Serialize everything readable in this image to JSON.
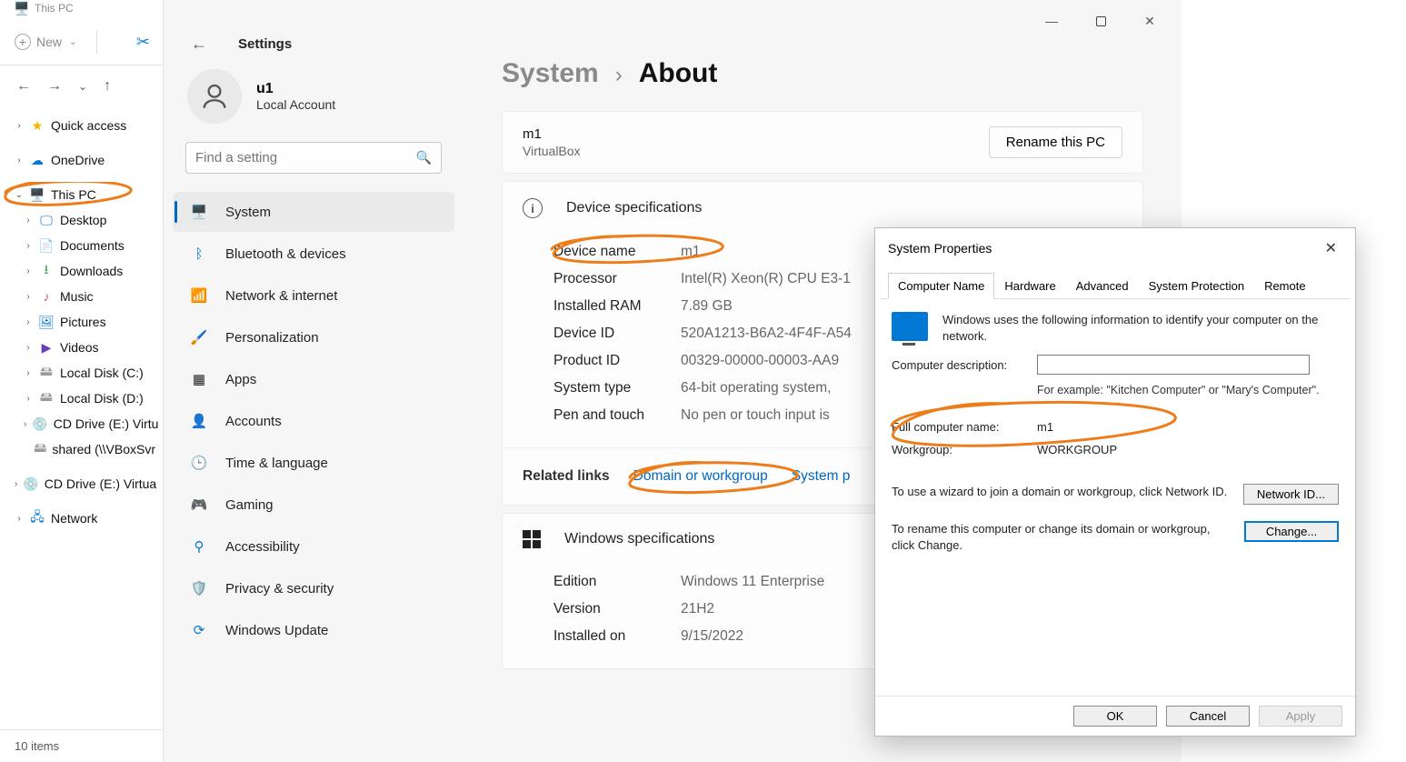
{
  "explorer": {
    "title": "This PC",
    "new_btn": "New",
    "status": "10 items",
    "tree": {
      "quick_access": "Quick access",
      "onedrive": "OneDrive",
      "this_pc": "This PC",
      "desktop": "Desktop",
      "documents": "Documents",
      "downloads": "Downloads",
      "music": "Music",
      "pictures": "Pictures",
      "videos": "Videos",
      "local_c": "Local Disk (C:)",
      "local_d": "Local Disk (D:)",
      "cd_e1": "CD Drive (E:) Virtu",
      "shared": "shared (\\\\VBoxSvr",
      "cd_e2": "CD Drive (E:) Virtua",
      "network": "Network"
    }
  },
  "settings": {
    "window_title": "Settings",
    "user": {
      "name": "u1",
      "sub": "Local Account"
    },
    "search_placeholder": "Find a setting",
    "nav": {
      "system": "System",
      "bluetooth": "Bluetooth & devices",
      "network": "Network & internet",
      "personalization": "Personalization",
      "apps": "Apps",
      "accounts": "Accounts",
      "time": "Time & language",
      "gaming": "Gaming",
      "accessibility": "Accessibility",
      "privacy": "Privacy & security",
      "update": "Windows Update"
    },
    "breadcrumb": {
      "root": "System",
      "page": "About"
    },
    "pc": {
      "name": "m1",
      "model": "VirtualBox",
      "rename": "Rename this PC"
    },
    "device_spec_title": "Device specifications",
    "specs": {
      "device_name_l": "Device name",
      "device_name_v": "m1",
      "processor_l": "Processor",
      "processor_v": "Intel(R) Xeon(R) CPU E3-1",
      "ram_l": "Installed RAM",
      "ram_v": "7.89 GB",
      "deviceid_l": "Device ID",
      "deviceid_v": "520A1213-B6A2-4F4F-A54",
      "productid_l": "Product ID",
      "productid_v": "00329-00000-00003-AA9",
      "systype_l": "System type",
      "systype_v": "64-bit operating system,",
      "pen_l": "Pen and touch",
      "pen_v": "No pen or touch input is"
    },
    "related": {
      "label": "Related links",
      "domain": "Domain or workgroup",
      "sysprot": "System p"
    },
    "winspec_title": "Windows specifications",
    "winspecs": {
      "edition_l": "Edition",
      "edition_v": "Windows 11 Enterprise",
      "version_l": "Version",
      "version_v": "21H2",
      "installed_l": "Installed on",
      "installed_v": "9/15/2022"
    }
  },
  "sysprops": {
    "title": "System Properties",
    "tabs": {
      "t0": "Computer Name",
      "t1": "Hardware",
      "t2": "Advanced",
      "t3": "System Protection",
      "t4": "Remote"
    },
    "intro": "Windows uses the following information to identify your computer on the network.",
    "desc_label": "Computer description:",
    "desc_value": "",
    "desc_hint": "For example: \"Kitchen Computer\" or \"Mary's Computer\".",
    "full_name_l": "Full computer name:",
    "full_name_v": "m1",
    "workgroup_l": "Workgroup:",
    "workgroup_v": "WORKGROUP",
    "wizard_txt": "To use a wizard to join a domain or workgroup, click Network ID.",
    "networkid_btn": "Network ID...",
    "change_txt": "To rename this computer or change its domain or workgroup, click Change.",
    "change_btn": "Change...",
    "ok": "OK",
    "cancel": "Cancel",
    "apply": "Apply"
  }
}
